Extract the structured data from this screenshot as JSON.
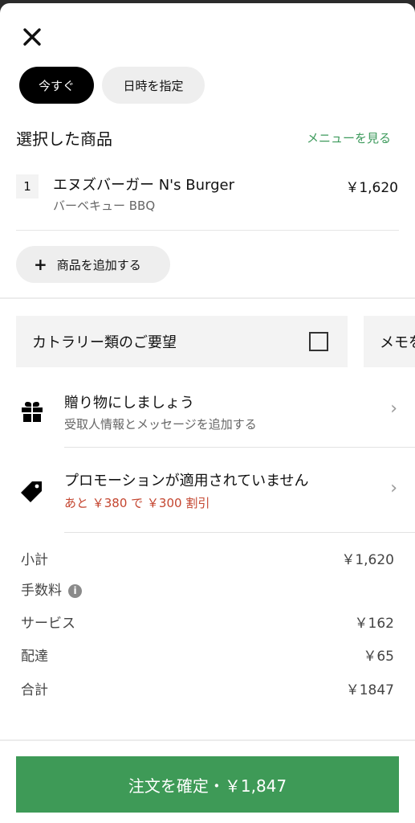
{
  "close": {
    "icon": "close-icon"
  },
  "timing": {
    "now": "今すぐ",
    "schedule": "日時を指定"
  },
  "selected": {
    "title": "選択した商品",
    "menu_link": "メニューを見る"
  },
  "item": {
    "qty": "1",
    "name": "エヌズバーガー N's Burger",
    "option": "バーベキュー BBQ",
    "price": "￥1,620"
  },
  "add_item": {
    "plus": "+",
    "label": "商品を追加する"
  },
  "cutlery": {
    "label": "カトラリー類のご要望"
  },
  "memo": {
    "label": "メモを"
  },
  "gift": {
    "title": "贈り物にしましょう",
    "subtitle": "受取人情報とメッセージを追加する"
  },
  "promo": {
    "title": "プロモーションが適用されていません",
    "subtitle": "あと ￥380 で ￥300 割引"
  },
  "chevron": "›",
  "fees": {
    "subtotal_label": "小計",
    "subtotal_value": "￥1,620",
    "fee_label": "手数料",
    "info": "i",
    "service_label": "サービス",
    "service_value": "￥162",
    "delivery_label": "配達",
    "delivery_value": "￥65",
    "total_label": "合計",
    "total_value": "￥1847"
  },
  "confirm": {
    "label": "注文を確定・￥1,847"
  },
  "colors": {
    "accent_green": "#3e9a57",
    "link_green": "#3d9a5c",
    "promo_red": "#c4452f"
  }
}
